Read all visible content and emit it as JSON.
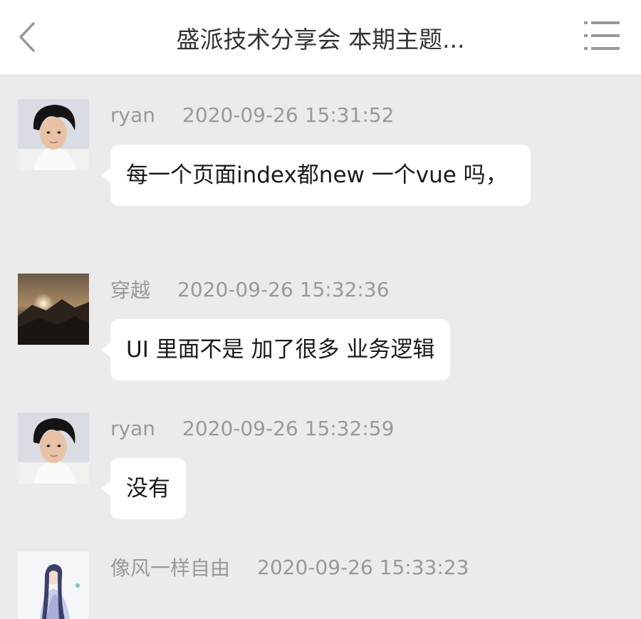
{
  "header": {
    "title": "盛派技术分享会 本期主题...",
    "back_icon": "chevron-left-icon",
    "menu_icon": "list-menu-icon"
  },
  "messages": [
    {
      "sender": "ryan",
      "time": "2020-09-26 15:31:52",
      "text": "每一个页面index都new 一个vue 吗，",
      "avatar": "photo-portrait-young-man"
    },
    {
      "sender": "穿越",
      "time": "2020-09-26 15:32:36",
      "text": "UI 里面不是 加了很多 业务逻辑",
      "avatar": "photo-mountain-sunset"
    },
    {
      "sender": "ryan",
      "time": "2020-09-26 15:32:59",
      "text": "没有",
      "avatar": "photo-portrait-young-man"
    },
    {
      "sender": "像风一样自由",
      "time": "2020-09-26 15:33:23",
      "text": "",
      "avatar": "illustration-anime-swordsman"
    }
  ],
  "colors": {
    "background": "#ebebeb",
    "header_bg": "#ffffff",
    "bubble_bg": "#ffffff",
    "meta_text": "#999999"
  }
}
